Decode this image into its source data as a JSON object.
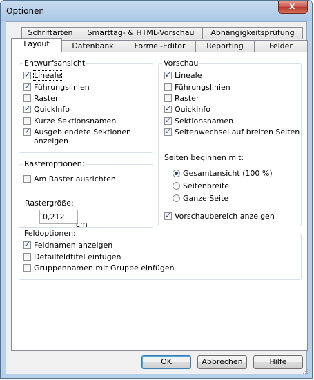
{
  "window": {
    "title": "Optionen",
    "close_label": "x"
  },
  "tabs_back": [
    {
      "label": "Schriftarten"
    },
    {
      "label": "Smarttag- & HTML-Vorschau"
    },
    {
      "label": "Abhängigkeitsprüfung"
    }
  ],
  "tabs_front": [
    {
      "label": "Layout",
      "active": true
    },
    {
      "label": "Datenbank"
    },
    {
      "label": "Formel-Editor"
    },
    {
      "label": "Reporting"
    },
    {
      "label": "Felder"
    }
  ],
  "entwurf": {
    "label": "Entwurfsansicht",
    "items": [
      {
        "label": "Lineale",
        "checked": true
      },
      {
        "label": "Führungslinien",
        "checked": true
      },
      {
        "label": "Raster",
        "checked": false
      },
      {
        "label": "QuickInfo",
        "checked": true
      },
      {
        "label": "Kurze Sektionsnamen",
        "checked": false
      },
      {
        "label": "Ausgeblendete Sektionen",
        "label2": "anzeigen",
        "checked": true
      }
    ]
  },
  "vorschau": {
    "label": "Vorschau",
    "items": [
      {
        "label": "Lineale",
        "checked": true
      },
      {
        "label": "Führungslinien",
        "checked": false
      },
      {
        "label": "Raster",
        "checked": false
      },
      {
        "label": "QuickInfo",
        "checked": true
      },
      {
        "label": "Sektionsnamen",
        "checked": true
      },
      {
        "label": "Seitenwechsel auf breiten Seiten",
        "checked": true
      }
    ],
    "seiten_label": "Seiten beginnen mit:",
    "radios": [
      {
        "label": "Gesamtansicht (100 %)",
        "checked": true
      },
      {
        "label": "Seitenbreite",
        "checked": false
      },
      {
        "label": "Ganze Seite",
        "checked": false
      }
    ],
    "vorschaubereich": {
      "label": "Vorschaubereich anzeigen",
      "checked": true
    }
  },
  "raster": {
    "label": "Rasteroptionen:",
    "ausrichten": {
      "label": "Am Raster ausrichten",
      "checked": false
    },
    "groesse_label": "Rastergröße:",
    "groesse_value": "0,212",
    "unit": "cm"
  },
  "feld": {
    "label": "Feldoptionen:",
    "items": [
      {
        "label": "Feldnamen anzeigen",
        "checked": true
      },
      {
        "label": "Detailfeldtitel einfügen",
        "checked": false
      },
      {
        "label": "Gruppennamen mit Gruppe einfügen",
        "checked": false
      }
    ]
  },
  "buttons": {
    "ok": "OK",
    "cancel": "Abbrechen",
    "help": "Hilfe"
  }
}
